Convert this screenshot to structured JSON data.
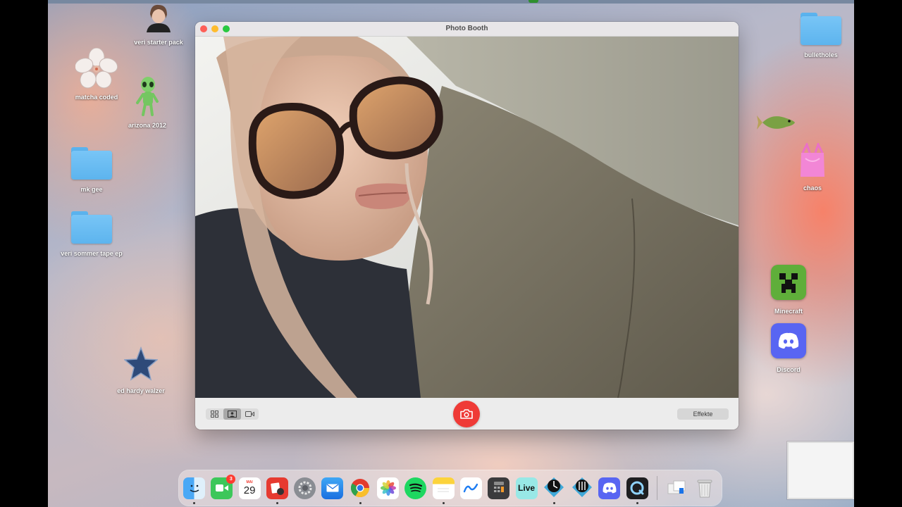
{
  "desktop": {
    "icons": [
      {
        "label": "veri starter pack"
      },
      {
        "label": "matcha coded"
      },
      {
        "label": "arizona 2012"
      },
      {
        "label": "mk gee"
      },
      {
        "label": "veri sommer tape ep"
      },
      {
        "label": "ed hardy walzer"
      },
      {
        "label": "bulletholes"
      },
      {
        "label": "chaos"
      },
      {
        "label": "Minecraft"
      },
      {
        "label": "Discord"
      }
    ]
  },
  "window": {
    "title": "Photo Booth",
    "effects_label": "Effekte"
  },
  "dock": {
    "facetime_badge": "3",
    "calendar_month": "MAI",
    "calendar_day": "29",
    "live_label": "Live"
  },
  "colors": {
    "shutter": "#ef3a36",
    "folder": "#78c5f6"
  }
}
